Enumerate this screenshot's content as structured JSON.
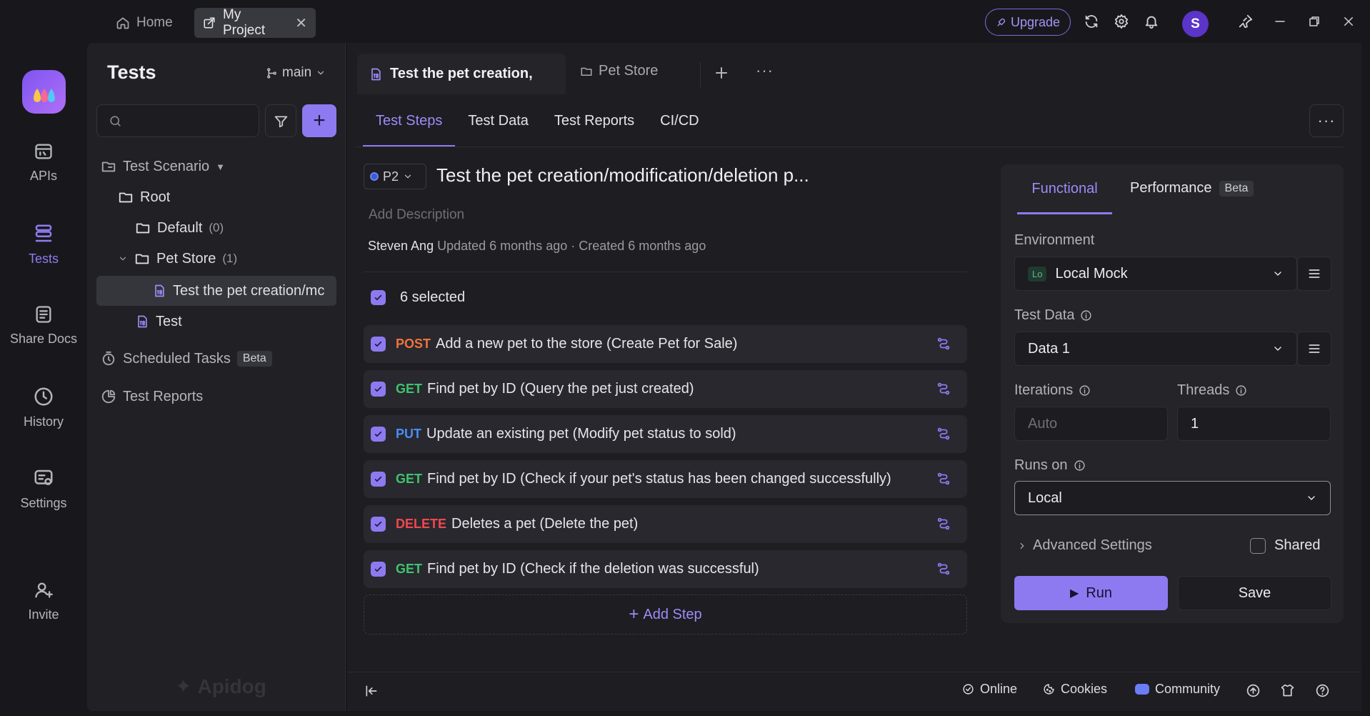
{
  "titlebar": {
    "home_label": "Home",
    "project_label": "My Project",
    "upgrade_label": "Upgrade",
    "avatar_initial": "S"
  },
  "rail": {
    "items": [
      {
        "label": "APIs",
        "icon": "api-icon"
      },
      {
        "label": "Tests",
        "icon": "tests-icon",
        "active": true
      },
      {
        "label": "Share Docs",
        "icon": "share-docs-icon"
      },
      {
        "label": "History",
        "icon": "history-icon"
      },
      {
        "label": "Settings",
        "icon": "settings-icon"
      },
      {
        "label": "Invite",
        "icon": "invite-icon"
      }
    ]
  },
  "sidebar": {
    "title": "Tests",
    "branch": "main",
    "tree": {
      "scenario": "Test Scenario",
      "root": "Root",
      "default": "Default",
      "default_count": "(0)",
      "pet_store": "Pet Store",
      "pet_store_count": "(1)",
      "case_selected": "Test the pet creation/mc",
      "case_test": "Test",
      "scheduled": "Scheduled Tasks",
      "scheduled_badge": "Beta",
      "reports": "Test Reports"
    },
    "watermark": "Apidog"
  },
  "doc_tabs": {
    "tab1": "Test the pet creation,",
    "tab2": "Pet Store"
  },
  "inner_tabs": [
    "Test Steps",
    "Test Data",
    "Test Reports",
    "CI/CD"
  ],
  "case": {
    "priority": "P2",
    "title": "Test the pet creation/modification/deletion p...",
    "description_placeholder": "Add Description",
    "author": "Steven Ang",
    "meta": "Updated 6 months ago · Created 6 months ago",
    "selected_label": "6 selected"
  },
  "steps": [
    {
      "method": "POST",
      "text": "Add a new pet to the store (Create Pet for Sale)"
    },
    {
      "method": "GET",
      "text": "Find pet by ID (Query the pet just created)"
    },
    {
      "method": "PUT",
      "text": "Update an existing pet (Modify pet status to sold)"
    },
    {
      "method": "GET",
      "text": "Find pet by ID (Check if your pet's status has been changed successfully)"
    },
    {
      "method": "DELETE",
      "text": "Deletes a pet (Delete the pet)"
    },
    {
      "method": "GET",
      "text": "Find pet by ID (Check if the deletion was successful)"
    }
  ],
  "add_step_label": "Add Step",
  "panel": {
    "tab_functional": "Functional",
    "tab_performance": "Performance",
    "performance_badge": "Beta",
    "environment_label": "Environment",
    "environment_badge": "Lo",
    "environment_value": "Local Mock",
    "test_data_label": "Test Data",
    "test_data_value": "Data 1",
    "iterations_label": "Iterations",
    "iterations_placeholder": "Auto",
    "threads_label": "Threads",
    "threads_value": "1",
    "runs_on_label": "Runs on",
    "runs_on_value": "Local",
    "advanced_label": "Advanced Settings",
    "shared_label": "Shared",
    "run_label": "Run",
    "save_label": "Save"
  },
  "footer": {
    "online": "Online",
    "cookies": "Cookies",
    "community": "Community"
  },
  "colors": {
    "accent": "#8d7af0",
    "post": "#f1733b",
    "get": "#3fc36f",
    "put": "#4a8cf7",
    "delete": "#f0484e"
  }
}
